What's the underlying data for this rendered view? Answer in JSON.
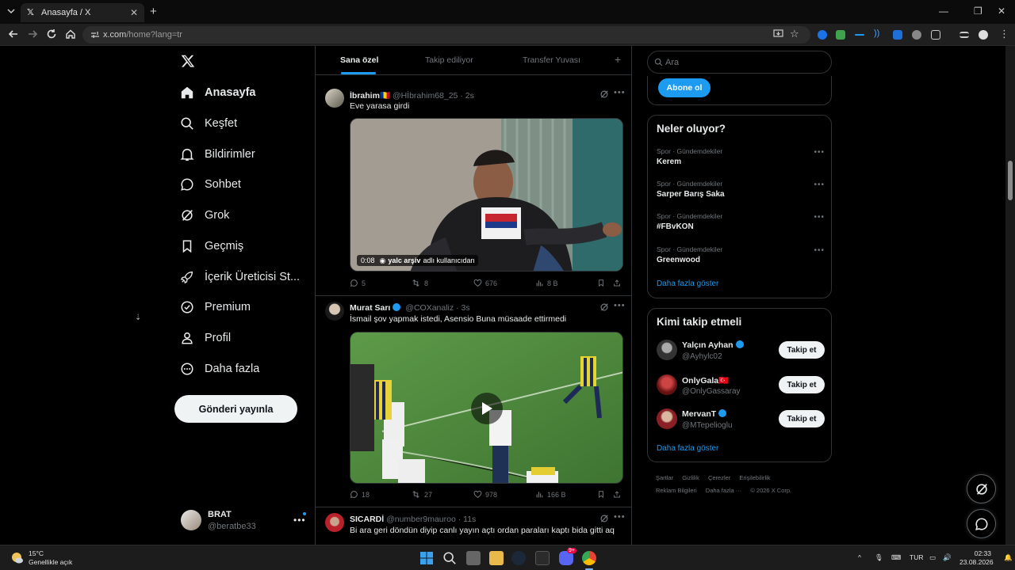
{
  "browser": {
    "tab_title": "Anasayfa / X",
    "url_host": "x.com",
    "url_rest": "/home?lang=tr"
  },
  "nav": {
    "items": [
      {
        "label": "Anasayfa",
        "icon": "home-icon"
      },
      {
        "label": "Keşfet",
        "icon": "search-icon"
      },
      {
        "label": "Bildirimler",
        "icon": "bell-icon"
      },
      {
        "label": "Sohbet",
        "icon": "chat-icon"
      },
      {
        "label": "Grok",
        "icon": "grok-icon"
      },
      {
        "label": "Geçmiş",
        "icon": "bookmark-icon"
      },
      {
        "label": "İçerik Üreticisi St...",
        "icon": "rocket-icon"
      },
      {
        "label": "Premium",
        "icon": "premium-icon"
      },
      {
        "label": "Profil",
        "icon": "profile-icon"
      },
      {
        "label": "Daha fazla",
        "icon": "more-icon"
      }
    ],
    "post_button": "Gönderi yayınla"
  },
  "account": {
    "name": "BRAT",
    "handle": "@beratbe33"
  },
  "timeline": {
    "tabs": [
      "Sana özel",
      "Takip ediliyor",
      "Transfer Yuvası"
    ],
    "tweets": [
      {
        "name": "İbrahim",
        "flag": "🇷🇴",
        "handle": "@Hİbrahim68_25",
        "time": "· 2s",
        "text": "Eve yarasa girdi",
        "video_time": "0:08",
        "video_credit_user": "yalc arşiv",
        "video_credit_suffix": "adlı kullanıcıdan",
        "replies": "5",
        "reposts": "8",
        "likes": "676",
        "views": "8 B"
      },
      {
        "name": "Murat Sarı",
        "handle": "@COXanaliz",
        "time": "· 3s",
        "text": "İsmail şov yapmak istedi, Asensio Buna müsaade ettirmedi",
        "replies": "18",
        "reposts": "27",
        "likes": "978",
        "views": "166 B"
      },
      {
        "name": "SICARDİ",
        "handle": "@number9mauroo",
        "time": "· 11s",
        "text": "Bi ara geri döndün diyip canlı yayın açtı ordan paraları kaptı bida gitti aq"
      }
    ]
  },
  "right": {
    "search_placeholder": "Ara",
    "subscribe": "Abone ol",
    "trends_title": "Neler oluyor?",
    "trends": [
      {
        "category": "Spor · Gündemdekiler",
        "name": "Kerem"
      },
      {
        "category": "Spor · Gündemdekiler",
        "name": "Sarper Barış Saka"
      },
      {
        "category": "Spor · Gündemdekiler",
        "name": "#FBvKON"
      },
      {
        "category": "Spor · Gündemdekiler",
        "name": "Greenwood"
      }
    ],
    "show_more": "Daha fazla göster",
    "who_title": "Kimi takip etmeli",
    "who": [
      {
        "name": "Yalçın Ayhan",
        "handle": "@Ayhylc02",
        "verified": true,
        "follow": "Takip et"
      },
      {
        "name": "OnlyGala🇹🇷",
        "handle": "@OnlyGassaray",
        "verified": false,
        "follow": "Takip et"
      },
      {
        "name": "MervanT",
        "handle": "@MTepelioglu",
        "verified": true,
        "follow": "Takip et"
      }
    ],
    "footer_line1": [
      "Şartlar",
      "Gizlilik",
      "Çerezler",
      "Erişilebilirlik"
    ],
    "footer_line2": [
      "Reklam Bilgileri",
      "Daha fazla ···",
      "© 2026 X Corp."
    ]
  },
  "taskbar": {
    "temp": "15°C",
    "weather": "Genellikle açık",
    "lang": "TUR",
    "time": "02:33",
    "date": "23.08.2026",
    "badge": "9+"
  },
  "colors": {
    "accent": "#1d9bf0",
    "background": "#000000",
    "border": "#2f3336"
  }
}
